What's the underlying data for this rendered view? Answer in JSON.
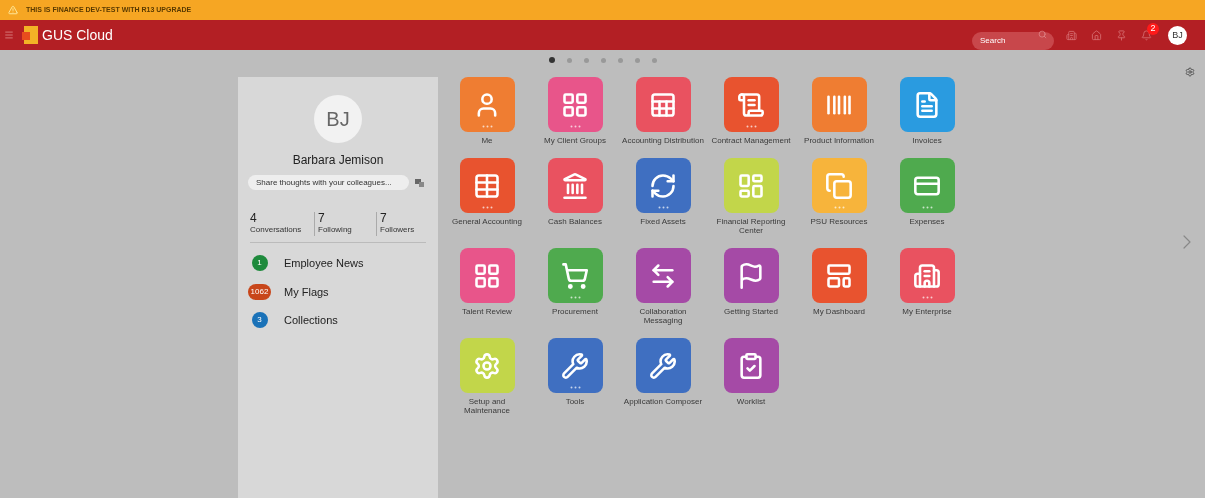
{
  "banner": {
    "text": "THIS IS FINANCE DEV-TEST WITH R13 UPGRADE"
  },
  "header": {
    "title": "GUS Cloud",
    "search": {
      "placeholder": "Search"
    },
    "notification_count": "2",
    "avatar": "BJ"
  },
  "pages": [
    {
      "selected": true
    },
    {
      "selected": false
    },
    {
      "selected": false
    },
    {
      "selected": false
    },
    {
      "selected": false
    },
    {
      "selected": false
    },
    {
      "selected": false
    }
  ],
  "profile": {
    "initials": "BJ",
    "name": "Barbara Jemison",
    "share": {
      "placeholder": "Share thoughts with your colleagues..."
    },
    "stats": [
      {
        "count": "4",
        "label": "Conversations"
      },
      {
        "count": "7",
        "label": "Following"
      },
      {
        "count": "7",
        "label": "Followers"
      }
    ],
    "links": [
      {
        "count": "1",
        "label": "Employee News",
        "color": "#1e8a3c"
      },
      {
        "count": "1062",
        "label": "My Flags",
        "color": "#c8461a"
      },
      {
        "count": "3",
        "label": "Collections",
        "color": "#1a72b8"
      }
    ]
  },
  "tiles": [
    {
      "label": "Me",
      "color": "#ef7d32",
      "more": true
    },
    {
      "label": "My Client Groups",
      "color": "#e8558a",
      "more": true
    },
    {
      "label": "Accounting Distribution",
      "color": "#e95260",
      "more": false
    },
    {
      "label": "Contract Management",
      "color": "#e8532f",
      "more": true
    },
    {
      "label": "Product Information",
      "color": "#ef7d32",
      "more": false
    },
    {
      "label": "Invoices",
      "color": "#2a9be0",
      "more": false
    },
    {
      "label": "General Accounting",
      "color": "#e8532f",
      "more": true
    },
    {
      "label": "Cash Balances",
      "color": "#e95260",
      "more": false
    },
    {
      "label": "Fixed Assets",
      "color": "#3f6fc1",
      "more": true
    },
    {
      "label": "Financial Reporting Center",
      "color": "#c2d64a",
      "more": false
    },
    {
      "label": "PSU Resources",
      "color": "#f7b43b",
      "more": true
    },
    {
      "label": "Expenses",
      "color": "#4faa4e",
      "more": true
    },
    {
      "label": "Talent Review",
      "color": "#e8558a",
      "more": false
    },
    {
      "label": "Procurement",
      "color": "#4faa4e",
      "more": true
    },
    {
      "label": "Collaboration Messaging",
      "color": "#a54aa6",
      "more": false
    },
    {
      "label": "Getting Started",
      "color": "#a54aa6",
      "more": false
    },
    {
      "label": "My Dashboard",
      "color": "#e8532f",
      "more": false
    },
    {
      "label": "My Enterprise",
      "color": "#e95260",
      "more": true
    },
    {
      "label": "Setup and Maintenance",
      "color": "#c2d64a",
      "more": false
    },
    {
      "label": "Tools",
      "color": "#3f6fc1",
      "more": true
    },
    {
      "label": "Application Composer",
      "color": "#3f6fc1",
      "more": false
    },
    {
      "label": "Worklist",
      "color": "#a54aa6",
      "more": false
    }
  ]
}
